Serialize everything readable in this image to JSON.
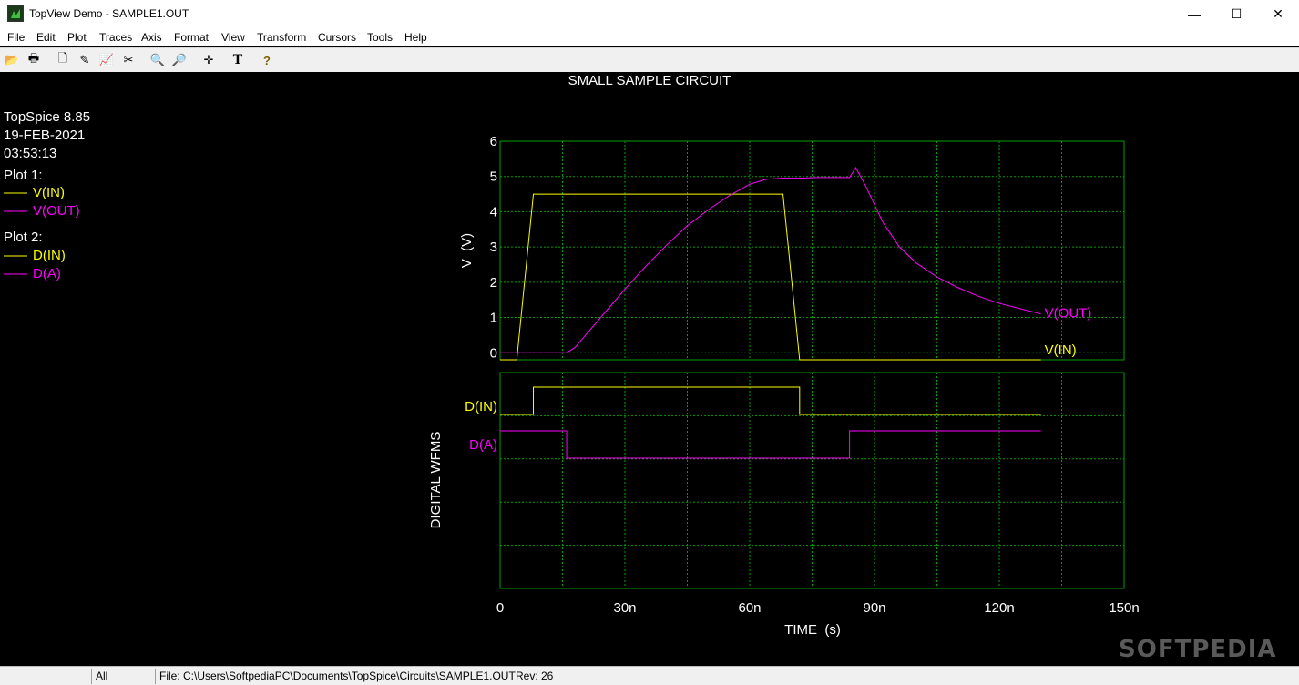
{
  "window": {
    "title": "TopView Demo - SAMPLE1.OUT",
    "min_glyph": "—",
    "max_glyph": "☐",
    "close_glyph": "✕"
  },
  "menu": [
    "File",
    "Edit",
    "Plot",
    "Traces",
    "Axis",
    "Format",
    "View",
    "Transform",
    "Cursors",
    "Tools",
    "Help"
  ],
  "toolbar": {
    "icons": [
      "open-icon",
      "print-icon",
      "document-icon",
      "pen-icon",
      "trace-chart-icon",
      "scissors-icon",
      "zoom-in-icon",
      "zoom-out-icon",
      "crosshair-icon",
      "text-icon",
      "help-icon"
    ],
    "glyphs": [
      "📂",
      "🖶",
      "🗋",
      "✎",
      "📈",
      "✂",
      "🔍",
      "🔎",
      "✛",
      "T",
      "?"
    ]
  },
  "plot": {
    "title": "SMALL SAMPLE CIRCUIT",
    "info": {
      "program": "TopSpice 8.85",
      "date": "19-FEB-2021",
      "time": "03:53:13"
    },
    "legend": {
      "plot1_label": "Plot 1:",
      "plot1_items": [
        {
          "name": "V(IN)",
          "color": "#ffff00"
        },
        {
          "name": "V(OUT)",
          "color": "#ff00ff"
        }
      ],
      "plot2_label": "Plot 2:",
      "plot2_items": [
        {
          "name": "D(IN)",
          "color": "#ffff00"
        },
        {
          "name": "D(A)",
          "color": "#ff00ff"
        }
      ]
    },
    "colors": {
      "background": "#000000",
      "grid": "#00a000",
      "text": "#ffffff",
      "yellow": "#ffff00",
      "magenta": "#ff00ff"
    }
  },
  "chart_data": [
    {
      "type": "line",
      "title": "SMALL SAMPLE CIRCUIT",
      "ylabel": "V  (V)",
      "xlabel": "TIME  (s)",
      "xlim": [
        0,
        150
      ],
      "ylim": [
        -0.2,
        6
      ],
      "x_unit": "n",
      "x_ticks": [
        "0",
        "30n",
        "60n",
        "90n",
        "120n",
        "150n"
      ],
      "y_ticks": [
        "0",
        "1",
        "2",
        "3",
        "4",
        "5",
        "6"
      ],
      "grid": true,
      "series": [
        {
          "name": "V(IN)",
          "color": "#ffff00",
          "x": [
            0,
            4,
            8,
            68,
            72,
            130
          ],
          "y": [
            -0.2,
            -0.2,
            4.5,
            4.5,
            -0.2,
            -0.2
          ]
        },
        {
          "name": "V(OUT)",
          "color": "#ff00ff",
          "x": [
            0,
            16,
            18,
            22,
            26,
            30,
            35,
            40,
            45,
            50,
            55,
            60,
            64,
            68,
            72,
            76,
            80,
            84,
            85.5,
            88,
            92,
            96,
            100,
            105,
            110,
            115,
            120,
            125,
            130
          ],
          "y": [
            0,
            0,
            0.15,
            0.7,
            1.25,
            1.8,
            2.45,
            3.05,
            3.6,
            4.05,
            4.45,
            4.78,
            4.92,
            4.95,
            4.95,
            4.97,
            4.97,
            4.97,
            5.25,
            4.7,
            3.7,
            3.0,
            2.55,
            2.15,
            1.85,
            1.6,
            1.4,
            1.25,
            1.1
          ]
        }
      ]
    },
    {
      "type": "line",
      "ylabel": "DIGITAL WFMS",
      "xlabel": "TIME  (s)",
      "xlim": [
        0,
        150
      ],
      "series": [
        {
          "name": "D(IN)",
          "color": "#ffff00",
          "x": [
            0,
            8,
            8,
            72,
            72,
            130
          ],
          "y": [
            0,
            0,
            1,
            1,
            0,
            0
          ]
        },
        {
          "name": "D(A)",
          "color": "#ff00ff",
          "x": [
            0,
            16,
            16,
            84,
            84,
            130
          ],
          "y": [
            1,
            1,
            0,
            0,
            1,
            1
          ]
        }
      ]
    }
  ],
  "status": {
    "mode": "All",
    "file": "File: C:\\Users\\SoftpediaPC\\Documents\\TopSpice\\Circuits\\SAMPLE1.OUT",
    "rev": "Rev: 26"
  },
  "watermark": "SOFTPEDIA"
}
